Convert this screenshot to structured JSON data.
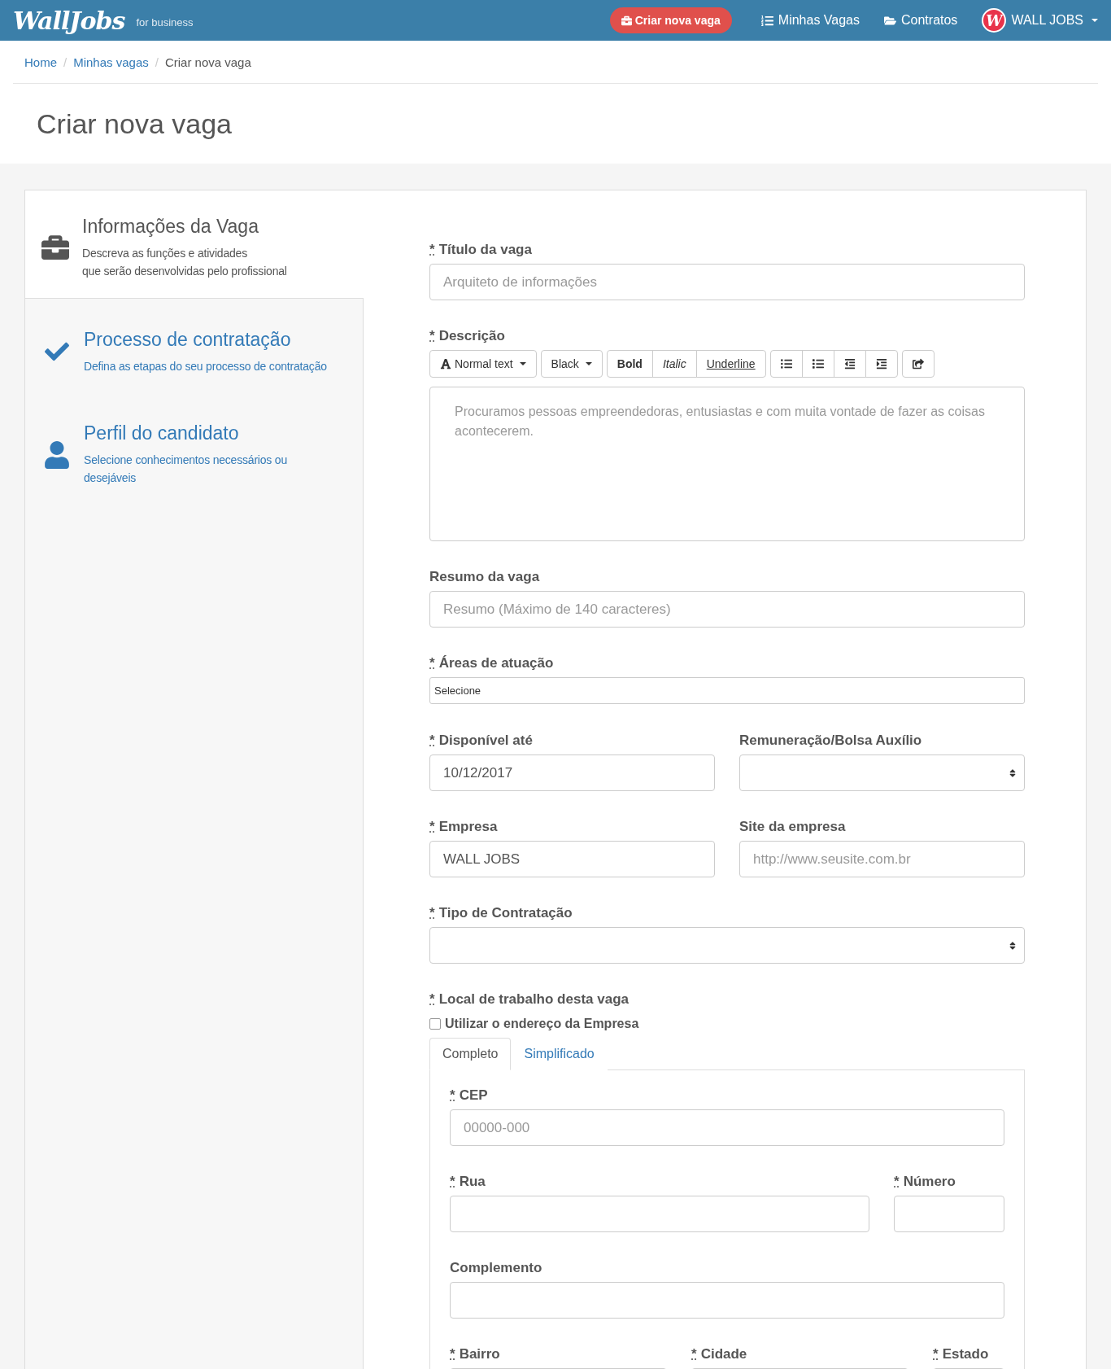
{
  "header": {
    "logo": "WallJobs",
    "tagline": "for business",
    "cta": "Criar nova vaga",
    "nav": [
      {
        "label": "Minhas Vagas",
        "kind": "list"
      },
      {
        "label": "Contratos",
        "kind": "folder"
      }
    ],
    "account": {
      "avatar": "W",
      "name": "WALL JOBS"
    }
  },
  "breadcrumb": {
    "separator": "/",
    "items": [
      {
        "label": "Home",
        "current": false
      },
      {
        "label": "Minhas vagas",
        "current": false
      },
      {
        "label": "Criar nova vaga",
        "current": true
      }
    ]
  },
  "page_title": "Criar nova vaga",
  "steps": [
    {
      "kind": "briefcase",
      "title": "Informações da Vaga",
      "description": "Descreva as funções e atividades\nque serão desenvolvidas pelo profissional",
      "selected": true
    },
    {
      "kind": "check",
      "title": "Processo de contratação",
      "description": "Defina as etapas do seu processo de contratação",
      "selected": false
    },
    {
      "kind": "user",
      "title": "Perfil do candidato",
      "description": "Selecione conhecimentos necessários ou desejáveis",
      "selected": false
    }
  ],
  "form": [
    {
      "fields": [
        {
          "kind": "text",
          "mark": "*",
          "label": "Título da vaga",
          "placeholder": "Arquiteto de informações"
        }
      ]
    },
    {
      "fields": [
        {
          "kind": "editor",
          "mark": "*",
          "label": "Descrição",
          "placeholder": "Procuramos pessoas empreendedoras, entusiastas e com muita vontade de fazer as coisas acontecerem.",
          "toolbar": [
            [
              {
                "kind": "font-dropdown",
                "label": "Normal text"
              }
            ],
            [
              {
                "kind": "dropdown",
                "label": "Black"
              }
            ],
            [
              {
                "kind": "bold",
                "label": "Bold"
              },
              {
                "kind": "italic",
                "label": "Italic"
              },
              {
                "kind": "underline",
                "label": "Underline"
              }
            ],
            [
              {
                "kind": "bullet-list"
              },
              {
                "kind": "numbered-list"
              },
              {
                "kind": "outdent"
              },
              {
                "kind": "indent"
              }
            ],
            [
              {
                "kind": "redo"
              }
            ]
          ]
        }
      ]
    },
    {
      "fields": [
        {
          "kind": "text",
          "label": "Resumo da vaga",
          "placeholder": "Resumo (Máximo de 140 caracteres)"
        }
      ]
    },
    {
      "fields": [
        {
          "kind": "small-select",
          "mark": "*",
          "label": "Áreas de atuação",
          "value": "Selecione"
        }
      ]
    },
    {
      "fields": [
        {
          "kind": "text",
          "mark": "*",
          "label": "Disponível até",
          "value": "10/12/2017"
        },
        {
          "kind": "select",
          "label": "Remuneração/Bolsa Auxílio"
        }
      ]
    },
    {
      "fields": [
        {
          "kind": "text",
          "mark": "*",
          "label": "Empresa",
          "value": "WALL JOBS"
        },
        {
          "kind": "text",
          "label": "Site da empresa",
          "placeholder": "http://www.seusite.com.br"
        }
      ]
    },
    {
      "fields": [
        {
          "kind": "select",
          "mark": "*",
          "label": "Tipo de Contratação"
        }
      ]
    }
  ],
  "location": {
    "mark": "*",
    "label": "Local de trabalho desta vaga",
    "checkbox": {
      "label": "Utilizar o endereço da Empresa",
      "checked": false
    },
    "tabs": [
      {
        "label": "Completo",
        "selected": true
      },
      {
        "label": "Simplificado",
        "selected": false
      }
    ],
    "rows": [
      {
        "fields": [
          {
            "kind": "text",
            "mark": "*",
            "label": "CEP",
            "placeholder": "00000-000"
          }
        ]
      },
      {
        "fields": [
          {
            "kind": "text",
            "mark": "*",
            "label": "Rua"
          },
          {
            "kind": "text",
            "mark": "*",
            "label": "Número"
          }
        ]
      },
      {
        "fields": [
          {
            "kind": "text",
            "label": "Complemento"
          }
        ]
      },
      {
        "fields": [
          {
            "kind": "text",
            "mark": "*",
            "label": "Bairro"
          },
          {
            "kind": "text",
            "mark": "*",
            "label": "Cidade"
          },
          {
            "kind": "text",
            "mark": "*",
            "label": "Estado"
          }
        ]
      }
    ]
  }
}
